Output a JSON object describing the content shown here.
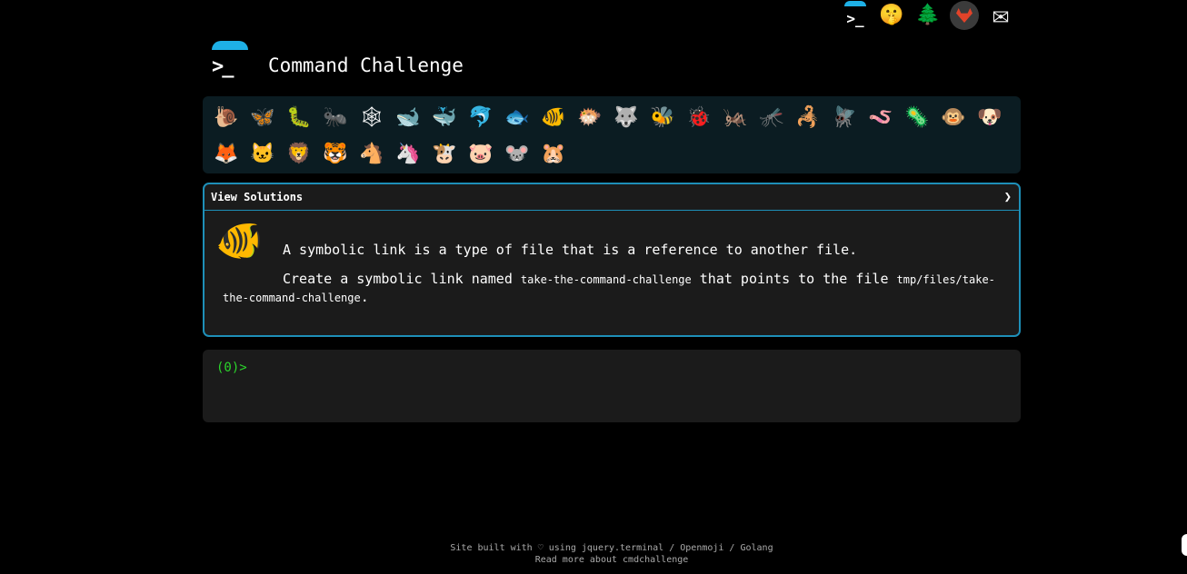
{
  "header": {
    "title": "Command Challenge",
    "logo_prompt": ">_"
  },
  "topbar": {
    "icons": [
      {
        "name": "terminal-icon",
        "glyph": ">_"
      },
      {
        "name": "shushing-face-icon",
        "glyph": "🤫"
      },
      {
        "name": "tree-icon",
        "glyph": "🌲"
      },
      {
        "name": "gitlab-icon",
        "glyph": ""
      },
      {
        "name": "mail-icon",
        "glyph": "✉"
      }
    ]
  },
  "animals": [
    {
      "name": "snail",
      "glyph": "🐌"
    },
    {
      "name": "butterfly",
      "glyph": "🦋"
    },
    {
      "name": "caterpillar",
      "glyph": "🐛"
    },
    {
      "name": "ant",
      "glyph": "🐜"
    },
    {
      "name": "spider-web",
      "glyph": "🕸"
    },
    {
      "name": "whale",
      "glyph": "🐋"
    },
    {
      "name": "spouting-whale",
      "glyph": "🐳"
    },
    {
      "name": "dolphin",
      "glyph": "🐬"
    },
    {
      "name": "fish",
      "glyph": "🐟"
    },
    {
      "name": "tropical-fish",
      "glyph": "🐠"
    },
    {
      "name": "blowfish",
      "glyph": "🐡"
    },
    {
      "name": "wolf",
      "glyph": "🐺"
    },
    {
      "name": "bee",
      "glyph": "🐝"
    },
    {
      "name": "ladybug",
      "glyph": "🐞"
    },
    {
      "name": "cricket",
      "glyph": "🦗"
    },
    {
      "name": "mosquito",
      "glyph": "🦟"
    },
    {
      "name": "scorpion",
      "glyph": "🦂"
    },
    {
      "name": "fly",
      "glyph": "🪰"
    },
    {
      "name": "worm",
      "glyph": "🪱"
    },
    {
      "name": "microbe",
      "glyph": "🦠"
    },
    {
      "name": "monkey-face",
      "glyph": "🐵"
    },
    {
      "name": "dog-face",
      "glyph": "🐶"
    },
    {
      "name": "fox",
      "glyph": "🦊"
    },
    {
      "name": "cat-face",
      "glyph": "🐱"
    },
    {
      "name": "lion",
      "glyph": "🦁"
    },
    {
      "name": "tiger",
      "glyph": "🐯"
    },
    {
      "name": "horse",
      "glyph": "🐴"
    },
    {
      "name": "unicorn",
      "glyph": "🦄"
    },
    {
      "name": "cow-face",
      "glyph": "🐮"
    },
    {
      "name": "pig-face",
      "glyph": "🐷"
    },
    {
      "name": "mouse-face",
      "glyph": "🐭"
    },
    {
      "name": "hamster",
      "glyph": "🐹"
    }
  ],
  "panel": {
    "header_label": "View Solutions",
    "toggle_glyph": "❯",
    "challenge_icon": "🐠",
    "line1": "A symbolic link is a type of file that is a reference to another file.",
    "line2_prefix": "Create a symbolic link named ",
    "link_name": "take-the-command-challenge",
    "line2_middle": " that points to the file ",
    "target_path": "tmp/files/take-the-command-challenge",
    "line2_suffix": "."
  },
  "terminal": {
    "prompt": "(0)>"
  },
  "footer": {
    "line1": "Site built with ♡ using jquery.terminal / Openmoji / Golang",
    "line2": "Read more about cmdchallenge"
  }
}
